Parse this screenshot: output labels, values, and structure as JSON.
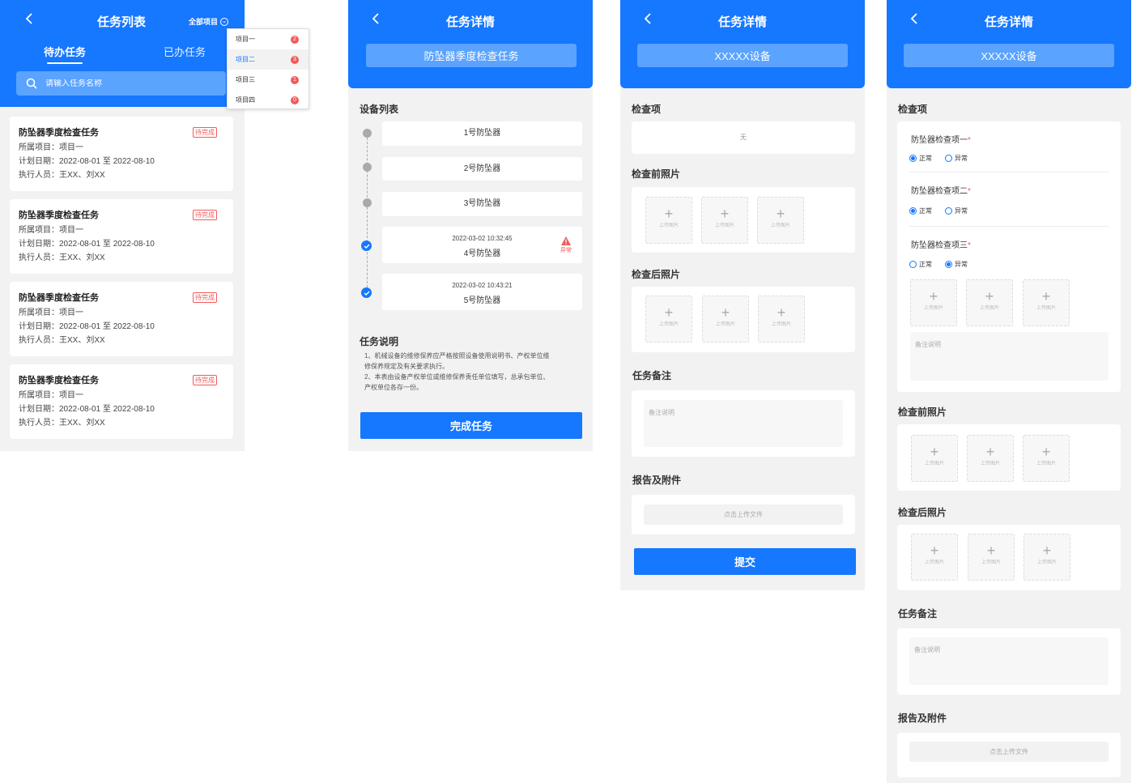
{
  "colors": {
    "primary": "#1677ff",
    "header_light": "#5aa3ff",
    "danger": "#f25a5a",
    "bg": "#f2f2f2"
  },
  "list": {
    "title": "任务列表",
    "all_projects": "全部项目",
    "tabs": [
      "待办任务",
      "已办任务"
    ],
    "search_placeholder": "请输入任务名称",
    "dropdown": [
      {
        "label": "项目一",
        "count": "2"
      },
      {
        "label": "项目二",
        "count": "3"
      },
      {
        "label": "项目三",
        "count": "1"
      },
      {
        "label": "项目四",
        "count": "0"
      }
    ],
    "tasks": [
      {
        "title": "防坠器季度检查任务",
        "status": "待完成",
        "project": "所属项目：项目一",
        "dates": "计划日期：2022-08-01 至 2022-08-10",
        "people": "执行人员：王XX、刘XX"
      },
      {
        "title": "防坠器季度检查任务",
        "status": "待完成",
        "project": "所属项目：项目一",
        "dates": "计划日期：2022-08-01 至 2022-08-10",
        "people": "执行人员：王XX、刘XX"
      },
      {
        "title": "防坠器季度检查任务",
        "status": "待完成",
        "project": "所属项目：项目一",
        "dates": "计划日期：2022-08-01 至 2022-08-10",
        "people": "执行人员：王XX、刘XX"
      },
      {
        "title": "防坠器季度检查任务",
        "status": "待完成",
        "project": "所属项目：项目一",
        "dates": "计划日期：2022-08-01 至 2022-08-10",
        "people": "执行人员：王XX、刘XX"
      }
    ]
  },
  "detail": {
    "title": "任务详情",
    "task_name": "防坠器季度检查任务",
    "devices_label": "设备列表",
    "devices": [
      {
        "name": "1号防坠器"
      },
      {
        "name": "2号防坠器"
      },
      {
        "name": "3号防坠器"
      },
      {
        "name": "4号防坠器",
        "time": "2022-03-02  10:32:45",
        "warn": "异常"
      },
      {
        "name": "5号防坠器",
        "time": "2022-03-02  10:43:21"
      }
    ],
    "desc_label": "任务说明",
    "desc_lines": [
      "1、机械设备的维修保养应严格按照设备使用说明书、产权单位维",
      "修保养规定及有关要求执行。",
      "2、本表由设备产权单位或维修保养责任单位填写，总承包单位、",
      "产权单位各存一份。"
    ],
    "complete_button": "完成任务"
  },
  "device": {
    "title": "任务详情",
    "device_name": "XXXXX设备",
    "check_items_label": "检查项",
    "none_text": "无",
    "before_photos_label": "检查前照片",
    "after_photos_label": "检查后照片",
    "upload_text": "上传图片",
    "note_label": "任务备注",
    "note_placeholder": "备注说明",
    "report_label": "报告及附件",
    "file_button": "点击上传文件",
    "submit_button": "提交"
  },
  "device2": {
    "title": "任务详情",
    "device_name": "XXXXX设备",
    "check_items_label": "检查项",
    "checks": [
      {
        "label": "防坠器检查项一",
        "selected": "正常"
      },
      {
        "label": "防坠器检查项二",
        "selected": "正常"
      },
      {
        "label": "防坠器检查项三",
        "selected": "异常"
      }
    ],
    "required_mark": "*",
    "opt_normal": "正常",
    "opt_abnormal": "异常",
    "upload_text": "上传图片",
    "note_placeholder": "备注说明",
    "before_photos_label": "检查前照片",
    "after_photos_label": "检查后照片",
    "note_label": "任务备注",
    "report_label": "报告及附件",
    "file_button": "点击上传文件"
  }
}
